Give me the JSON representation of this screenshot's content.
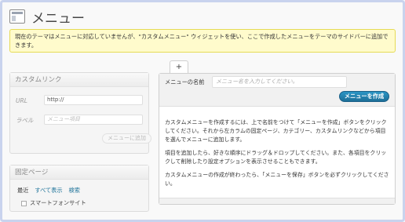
{
  "header": {
    "title": "メニュー",
    "icon": "menu-page-icon"
  },
  "notice": {
    "text": "現在のテーマはメニューに対応していませんが、\"カスタムメニュー\" ウィジェットを使い、ここで作成したメニューをテーマのサイドバーに追加できます。"
  },
  "custom_link": {
    "title": "カスタムリンク",
    "url_label": "URL",
    "url_value": "http://",
    "label_label": "ラベル",
    "label_placeholder": "メニュー項目",
    "add_button": "メニューに追加"
  },
  "pages": {
    "title": "固定ページ",
    "tabs": [
      "最近",
      "すべて表示",
      "検索"
    ],
    "items": [
      "スマートフォンサイト"
    ]
  },
  "menu_editor": {
    "add_tab": "+",
    "name_label": "メニューの名前",
    "name_placeholder": "メニュー名を入力してください。",
    "create_button": "メニューを作成",
    "instructions": [
      "カスタムメニューを作成するには、上で名前をつけて「メニューを作成」ボタンをクリックしてください。それから左カラムの固定ページ、カテゴリー、カスタムリンクなどから項目を選んでメニューに追加します。",
      "項目を追加したら、好きな順序にドラッグ＆ドロップしてください。また、各項目をクリックして削除したり設定オプションを表示させることもできます。",
      "カスタムメニューの作成が終わったら、「メニューを保存」ボタンを必ずクリックしてください。"
    ]
  },
  "colors": {
    "accent": "#21759b",
    "notice_bg": "#fffbcc",
    "primary_button": "#2a95c5"
  }
}
